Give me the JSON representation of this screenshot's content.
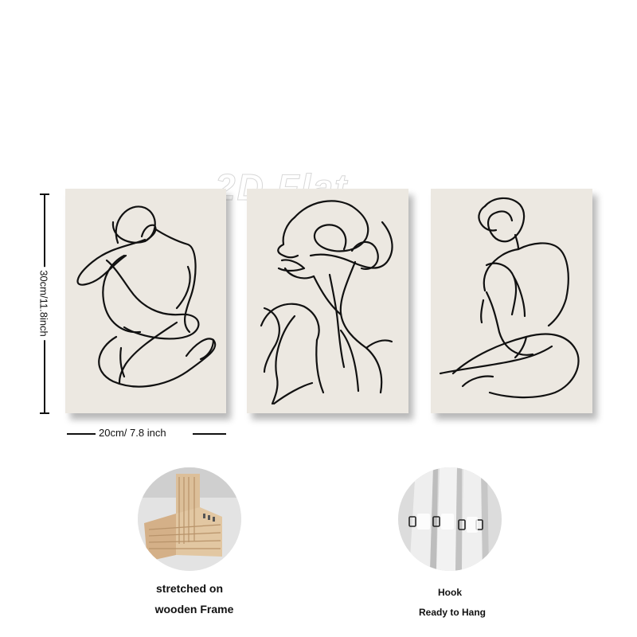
{
  "watermark": "2D Flat",
  "dimensions": {
    "height_label": "30cm/11.8inch",
    "width_label": "20cm/ 7.8 inch"
  },
  "panels": [
    {
      "subject": "seated-figure-line-art"
    },
    {
      "subject": "face-profile-line-art"
    },
    {
      "subject": "back-view-figure-line-art"
    }
  ],
  "features": [
    {
      "caption_line1": "stretched on",
      "caption_line2": "wooden Frame"
    },
    {
      "caption_line1": "Hook",
      "caption_line2": "Ready to Hang"
    }
  ],
  "colors": {
    "canvas": "#ece8e1",
    "line": "#111111",
    "wood": "#d9b891"
  }
}
